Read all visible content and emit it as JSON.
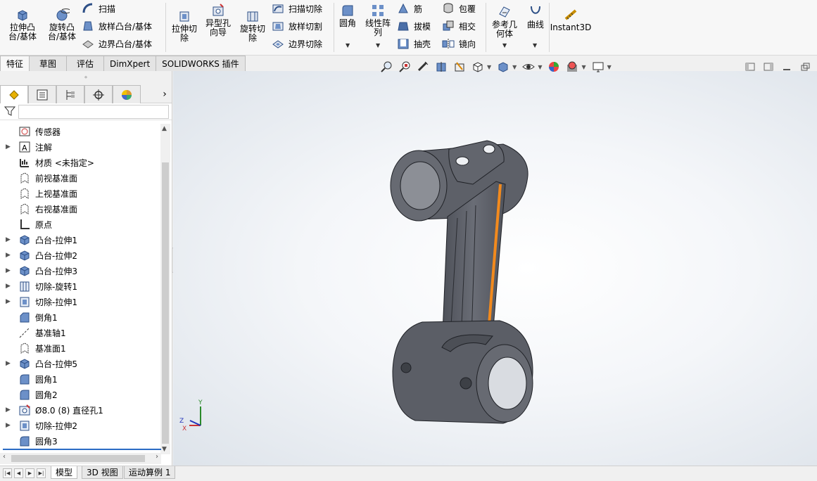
{
  "ribbon": {
    "extrude_boss": "拉伸凸\n台/基体",
    "revolve_boss": "旋转凸\n台/基体",
    "sweep": "扫描",
    "loft_boss": "放样凸台/基体",
    "boundary_boss": "边界凸台/基体",
    "extrude_cut": "拉伸切\n除",
    "hole_wizard": "异型孔\n向导",
    "revolve_cut": "旋转切\n除",
    "swept_cut": "扫描切除",
    "lofted_cut": "放样切割",
    "boundary_cut": "边界切除",
    "fillet": "圆角",
    "linear_pattern": "线性阵\n列",
    "rib": "筋",
    "draft": "拔模",
    "shell": "抽壳",
    "wrap": "包覆",
    "intersect": "相交",
    "mirror": "镜向",
    "ref_geometry": "参考几\n何体",
    "curves": "曲线",
    "instant3d": "Instant3D"
  },
  "cmd_tabs": [
    "特征",
    "草图",
    "评估",
    "DimXpert",
    "SOLIDWORKS 插件"
  ],
  "tree": [
    {
      "label": "传感器",
      "expand": false,
      "icon": "sensor-icon"
    },
    {
      "label": "注解",
      "expand": true,
      "icon": "annotation-icon"
    },
    {
      "label": "材质 <未指定>",
      "expand": false,
      "icon": "material-icon"
    },
    {
      "label": "前视基准面",
      "expand": false,
      "icon": "plane-icon"
    },
    {
      "label": "上视基准面",
      "expand": false,
      "icon": "plane-icon"
    },
    {
      "label": "右视基准面",
      "expand": false,
      "icon": "plane-icon"
    },
    {
      "label": "原点",
      "expand": false,
      "icon": "origin-icon"
    },
    {
      "label": "凸台-拉伸1",
      "expand": true,
      "icon": "boss-extrude-icon"
    },
    {
      "label": "凸台-拉伸2",
      "expand": true,
      "icon": "boss-extrude-icon"
    },
    {
      "label": "凸台-拉伸3",
      "expand": true,
      "icon": "boss-extrude-icon"
    },
    {
      "label": "切除-旋转1",
      "expand": true,
      "icon": "cut-revolve-icon"
    },
    {
      "label": "切除-拉伸1",
      "expand": true,
      "icon": "cut-extrude-icon"
    },
    {
      "label": "倒角1",
      "expand": false,
      "icon": "chamfer-icon"
    },
    {
      "label": "基准轴1",
      "expand": false,
      "icon": "axis-icon"
    },
    {
      "label": "基准面1",
      "expand": false,
      "icon": "plane-icon"
    },
    {
      "label": "凸台-拉伸5",
      "expand": true,
      "icon": "boss-extrude-icon"
    },
    {
      "label": "圆角1",
      "expand": false,
      "icon": "fillet-icon"
    },
    {
      "label": "圆角2",
      "expand": false,
      "icon": "fillet-icon"
    },
    {
      "label": "Ø8.0 (8) 直径孔1",
      "expand": true,
      "icon": "hole-icon"
    },
    {
      "label": "切除-拉伸2",
      "expand": true,
      "icon": "cut-extrude-icon"
    },
    {
      "label": "圆角3",
      "expand": false,
      "icon": "fillet-icon"
    }
  ],
  "bottom_tabs": [
    "模型",
    "3D 视图",
    "运动算例 1"
  ],
  "triad": {
    "y": "Y",
    "z": "Z",
    "x": "X"
  },
  "colors": {
    "model": "#5f626b",
    "highlight": "#f28a1d",
    "accent": "#2b6cc4"
  }
}
